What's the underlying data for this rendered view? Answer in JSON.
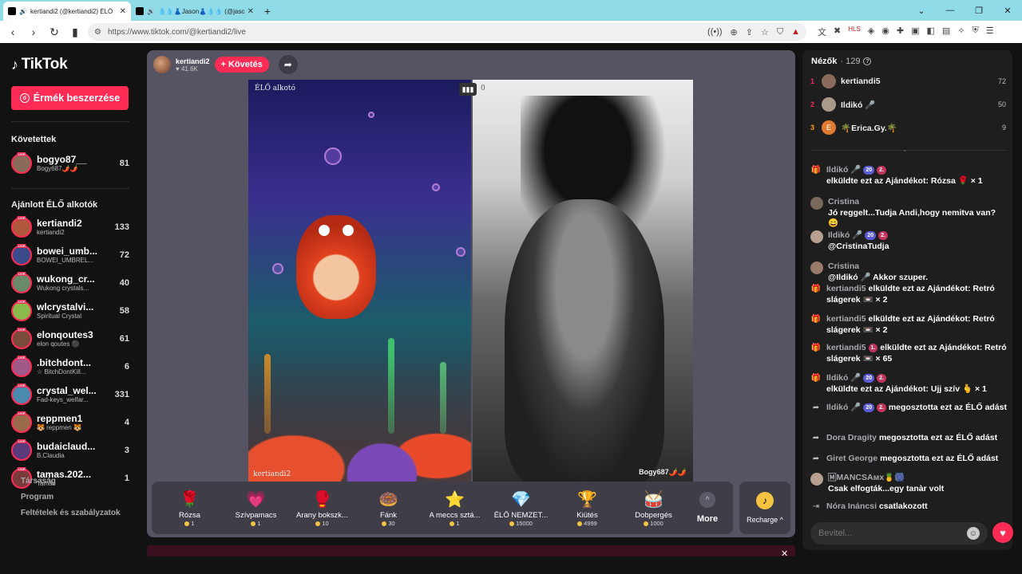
{
  "browser": {
    "tabs": [
      {
        "label": "kertiandi2 (@kertiandi2) ÉLŐ"
      },
      {
        "label": "💧💧👗Jason👗💧💧 (@jason_sam"
      }
    ],
    "url": "https://www.tiktok.com/@kertiandi2/live"
  },
  "sidebar": {
    "logo": "TikTok",
    "get_coins": "Érmék beszerzése",
    "following_title": "Követettek",
    "following": [
      {
        "name": "bogyo87__",
        "sub": "Bogy687🌶️🌶️",
        "count": "81",
        "color": "#8a6b5a"
      }
    ],
    "recommended_title": "Ajánlott ÉLŐ alkotók",
    "recommended": [
      {
        "name": "kertiandi2",
        "sub": "kertiandi2",
        "count": "133",
        "color": "#b0563a"
      },
      {
        "name": "bowei_umb...",
        "sub": "BOWEI_UMBREL...",
        "count": "72",
        "color": "#3a4a8a"
      },
      {
        "name": "wukong_cr...",
        "sub": "Wukong crystals...",
        "count": "40",
        "color": "#6a8a6a"
      },
      {
        "name": "wlcrystalvi...",
        "sub": "Spiritual Crystal",
        "count": "58",
        "color": "#8abb4a"
      },
      {
        "name": "elonqoutes3",
        "sub": "elon qoutes ⚫",
        "count": "61",
        "color": "#7a4a3a"
      },
      {
        "name": ".bitchdont...",
        "sub": "☆ BitchDontKill...",
        "count": "6",
        "color": "#a05a8a"
      },
      {
        "name": "crystal_wel...",
        "sub": "Fad-keys_welfar...",
        "count": "331",
        "color": "#4a8ab0"
      },
      {
        "name": "reppmen1",
        "sub": "🐯 reppmen 🐯",
        "count": "4",
        "color": "#9a6a4a"
      },
      {
        "name": "budaiclaud...",
        "sub": "B.Claudia",
        "count": "3",
        "color": "#5a3a7a"
      },
      {
        "name": "tamas.202...",
        "sub": "Tamás",
        "count": "1",
        "color": "#7a3a3a"
      }
    ],
    "links": [
      "Társaság",
      "Program",
      "Feltételek és szabályzatok"
    ]
  },
  "stream": {
    "host_name": "kertiandi2",
    "host_likes": "♥ 41.6K",
    "follow_label": "+ Követés",
    "left_label_top": "ÉLŐ alkotó",
    "left_label_bottom": "kertiandi2",
    "right_label_bottom": "Bogy687🌶️🌶️",
    "right_score": "0"
  },
  "gifts": [
    {
      "name": "Rózsa",
      "price": "1",
      "icon": "🌹"
    },
    {
      "name": "Szívpamacs",
      "price": "1",
      "icon": "💗"
    },
    {
      "name": "Arany bokszk...",
      "price": "10",
      "icon": "🥊"
    },
    {
      "name": "Fánk",
      "price": "30",
      "icon": "🍩"
    },
    {
      "name": "A meccs sztá...",
      "price": "1",
      "icon": "⭐"
    },
    {
      "name": "ÉLŐ NEMZET...",
      "price": "15000",
      "icon": "💎"
    },
    {
      "name": "Kiütés",
      "price": "4999",
      "icon": "🏆"
    },
    {
      "name": "Dobpergés",
      "price": "1000",
      "icon": "🥁"
    }
  ],
  "more_label": "More",
  "recharge_label": "Recharge ^",
  "viewers": {
    "title": "Nézők",
    "count": "· 129",
    "top": [
      {
        "rank": "1",
        "name": "kertiandi5",
        "count": "72",
        "color": "#8a6a5a"
      },
      {
        "rank": "2",
        "name": "Ildikó 🎤",
        "count": "50",
        "color": "#aa9a8a"
      },
      {
        "rank": "3",
        "name": "🌴Erica.Gy.🌴",
        "count": "9",
        "color": "#e07a30",
        "initial": "E"
      }
    ]
  },
  "chat": [
    {
      "icon": "gift",
      "user": "Ildikó 🎤",
      "badges": [
        "20",
        "2."
      ],
      "text": "elküldte ezt az Ajándékot: Rózsa 🌹 × 1"
    },
    {
      "icon": "avatar",
      "user": "Cristina",
      "text": "Jó reggelt...Tudja Andi,hogy nemitva van? 😄"
    },
    {
      "icon": "avatar",
      "user": "Ildikó 🎤",
      "badges": [
        "20",
        "2."
      ],
      "text": "@CristinaTudja"
    },
    {
      "icon": "avatar",
      "user": "Cristina",
      "text": "@Ildikó 🎤 Akkor szuper."
    },
    {
      "icon": "gift",
      "user": "kertiandi5",
      "text": "elküldte ezt az Ajándékot: Retró slágerek 📼 × 2"
    },
    {
      "icon": "gift",
      "user": "kertiandi5",
      "text": "elküldte ezt az Ajándékot: Retró slágerek 📼 × 2"
    },
    {
      "icon": "gift",
      "user": "kertiandi5",
      "badges": [
        "1."
      ],
      "text": "elküldte ezt az Ajándékot: Retró slágerek 📼 × 65"
    },
    {
      "icon": "gift",
      "user": "Ildikó 🎤",
      "badges": [
        "20",
        "2."
      ],
      "text": "elküldte ezt az Ajándékot: Ujj szív 🫰 × 1"
    },
    {
      "icon": "share",
      "user": "Ildikó 🎤",
      "badges": [
        "20",
        "2."
      ],
      "text": "megosztotta ezt az ÉLŐ adást"
    },
    {
      "icon": "share",
      "user": "Dora Dragity",
      "text": "megosztotta ezt az ÉLŐ adást"
    },
    {
      "icon": "share",
      "user": "Giret George",
      "text": "megosztotta ezt az ÉLŐ adást"
    },
    {
      "icon": "avatar",
      "user": "🄼MANCSAмх🍍🎆",
      "text": "Csak elfogták...egy tanàr volt"
    },
    {
      "icon": "join",
      "user": "Nóra Ináncsi",
      "text": "csatlakozott"
    }
  ],
  "chat_input_placeholder": "Bevitel..."
}
